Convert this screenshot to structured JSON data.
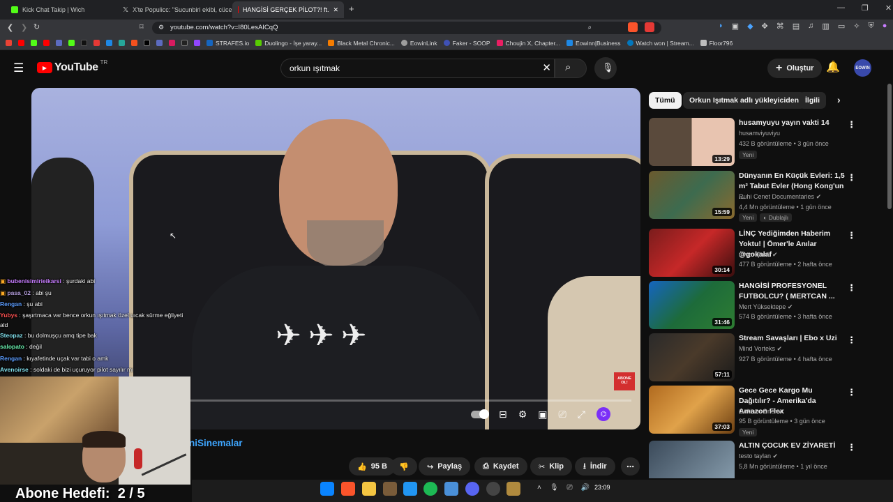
{
  "browser": {
    "tabs": [
      {
        "title": "Kick Chat Takip | Wich",
        "icon_color": "#53fc18"
      },
      {
        "title": "X'te Populicc: \"Sucunbiri ekibi, cücele",
        "icon_color": "#ffffff"
      },
      {
        "title": "HANGİSİ GERÇEK PİLOT?! ft.",
        "icon_color": "#ff0000"
      }
    ],
    "new_tab": "+",
    "url": "youtube.com/watch?v=I80LesAICqQ",
    "bookmarks": [
      {
        "label": "STRAFES.io",
        "color": "#1565c0"
      },
      {
        "label": "Duolingo - İşe yaray...",
        "color": "#58cc02"
      },
      {
        "label": "Black Metal Chronic...",
        "color": "#f57c00"
      },
      {
        "label": "EowinLink",
        "color": "#9e9e9e"
      },
      {
        "label": "Faker - SOOP",
        "color": "#3f51b5"
      },
      {
        "label": "Choujin X, Chapter...",
        "color": "#e91e63"
      },
      {
        "label": "Eowinn|Business",
        "color": "#1e88e5"
      },
      {
        "label": "Watch won | Stream...",
        "color": "#0277bd"
      },
      {
        "label": "Floor796",
        "color": "#bdbdbd"
      }
    ]
  },
  "yt": {
    "logo": "YouTube",
    "region": "TR",
    "search_value": "orkun ışıtmak",
    "create_label": "Oluştur",
    "avatar_text": "EOWIN"
  },
  "video": {
    "channel_partial": "niSinemalar",
    "like_count": "95 B",
    "share_label": "Paylaş",
    "save_label": "Kaydet",
    "clip_label": "Klip",
    "download_label": "İndir",
    "watermark": "ABONE OL!"
  },
  "chat": [
    {
      "user": "bubenisimirieikarsi",
      "msg": "şurdaki abi",
      "color": "#c77dff"
    },
    {
      "user": "pasa_02",
      "msg": "abi şu",
      "color": "#b39ddb"
    },
    {
      "user": "Rengan",
      "msg": "şu abi",
      "color": "#5c9dff"
    },
    {
      "user": "Yubys",
      "msg": "şaşırtmaca var bence orkun ışıtmak özel uıcak sürme eğliyeti ald",
      "color": "#ff5252"
    },
    {
      "user": "Steopaz",
      "msg": "bu dolmuşçu amq tipe bak",
      "color": "#80deea"
    },
    {
      "user": "salopato",
      "msg": "değil",
      "color": "#69f0ae"
    },
    {
      "user": "Rengan",
      "msg": "kıyafetinde uçak var tabi o amk",
      "color": "#5c9dff"
    },
    {
      "user": "Avenoirse",
      "msg": "soldaki de bizi uçuruyor pilot sayılır mı",
      "color": "#80deea"
    }
  ],
  "overlay": {
    "goal_label": "Abone Hedefi:",
    "goal_value": "2 / 5"
  },
  "sidebar": {
    "chips": [
      "Tümü",
      "Orkun Işıtmak adlı yükleyiciden",
      "İlgili"
    ],
    "recs": [
      {
        "title": "husamyuyu yayın vakti 14",
        "channel": "husamviyuviyu",
        "views": "432 B görüntüleme",
        "age": "3 gün önce",
        "duration": "13:29",
        "badges": [
          "Yeni"
        ],
        "verified": false,
        "thumb": "#5a4a3c"
      },
      {
        "title": "Dünyanın En Küçük Evleri: 1,5 m² Tabut Evler (Hong Kong'un ...",
        "channel": "Ruhi Cenet Documentaries",
        "views": "4,4 Mn görüntüleme",
        "age": "1 gün önce",
        "duration": "15:59",
        "badges": [
          "Yeni",
          "Dublajlı"
        ],
        "verified": true,
        "thumb": "#6b5a2e"
      },
      {
        "title": "LİNÇ Yediğimden Haberim Yoktu! | Ömer'le Anılar @gokalaf",
        "channel": "Ömer Şanlı",
        "views": "477 B görüntüleme",
        "age": "2 hafta önce",
        "duration": "30:14",
        "badges": [],
        "verified": true,
        "thumb": "#7a1c1c"
      },
      {
        "title": "HANGİSİ PROFESYONEL FUTBOLCU? ( MERTCAN ...",
        "channel": "Mert Yüksektepe",
        "views": "574 B görüntüleme",
        "age": "3 hafta önce",
        "duration": "31:46",
        "badges": [],
        "verified": true,
        "thumb": "#1d6b3a"
      },
      {
        "title": "Stream Savaşları | Ebo x Uzi",
        "channel": "Mind Vorteks",
        "views": "927 B görüntüleme",
        "age": "4 hafta önce",
        "duration": "57:11",
        "badges": [],
        "verified": true,
        "thumb": "#2a2a2a"
      },
      {
        "title": "Gece Gece Kargo Mu Dağıtılır? - Amerika'da Amazon Flex",
        "channel": "Gokhan Oner",
        "views": "95 B görüntüleme",
        "age": "3 gün önce",
        "duration": "37:03",
        "badges": [
          "Yeni"
        ],
        "verified": true,
        "thumb": "#b06a1f"
      },
      {
        "title": "ALTIN ÇOCUK EV ZİYARETİ",
        "channel": "testo taylan",
        "views": "5,8 Mn görüntüleme",
        "age": "1 yıl önce",
        "duration": "",
        "badges": [],
        "verified": true,
        "thumb": "#3b4a5a"
      }
    ]
  },
  "taskbar": {
    "time": "23:09"
  }
}
